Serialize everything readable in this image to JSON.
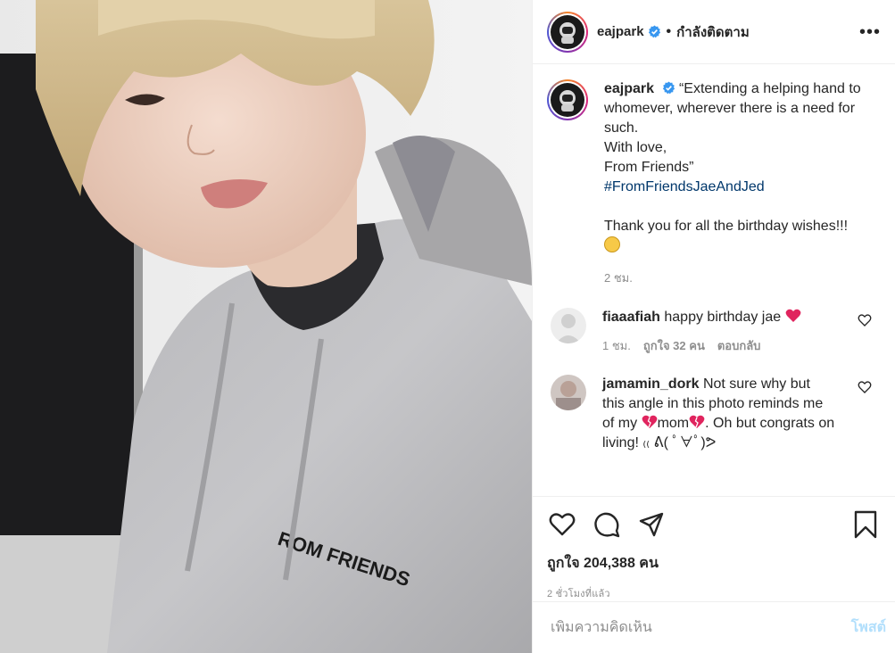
{
  "post": {
    "photo_print_text": "ROM FRIENDS"
  },
  "header": {
    "username": "eajpark",
    "separator": "•",
    "follow_status": "กำลังติดตาม",
    "more_label": "•••"
  },
  "caption": {
    "username": "eajpark",
    "lines": [
      "“Extending a helping hand to whomever, wherever there is a need for such.",
      "With love,",
      "From Friends”"
    ],
    "hashtag": "#FromFriendsJaeAndJed",
    "thanks": "Thank you for all the birthday wishes!!!",
    "time": "2 ชม."
  },
  "comments": [
    {
      "username": "fiaaafiah",
      "text": "happy birthday jae",
      "time": "1 ชม.",
      "likes": "ถูกใจ 32 คน",
      "reply": "ตอบกลับ"
    },
    {
      "username": "jamamin_dork",
      "text_a": "Not sure why but this angle in this photo reminds me of my",
      "text_b": "mom",
      "text_c": ". Oh but congrats on living! ₍₍ ᕕ( ﾟ∀ﾟ)ᕗ"
    }
  ],
  "actions": {
    "likes_text": "ถูกใจ 204,388 คน",
    "posted": "2 ชั่วโมงที่แล้ว"
  },
  "composer": {
    "placeholder": "เพิ่มความคิดเห็น",
    "post_label": "โพสต์"
  },
  "colors": {
    "link": "#00376b",
    "secondary_text": "#8e8e8e",
    "post_button_disabled": "#b2dffc",
    "verified": "#3897f0",
    "heart_emoji": "#e0245e"
  },
  "icons": [
    "heart-icon",
    "comment-icon",
    "share-icon",
    "bookmark-icon",
    "verified-badge-icon",
    "more-options-icon"
  ]
}
